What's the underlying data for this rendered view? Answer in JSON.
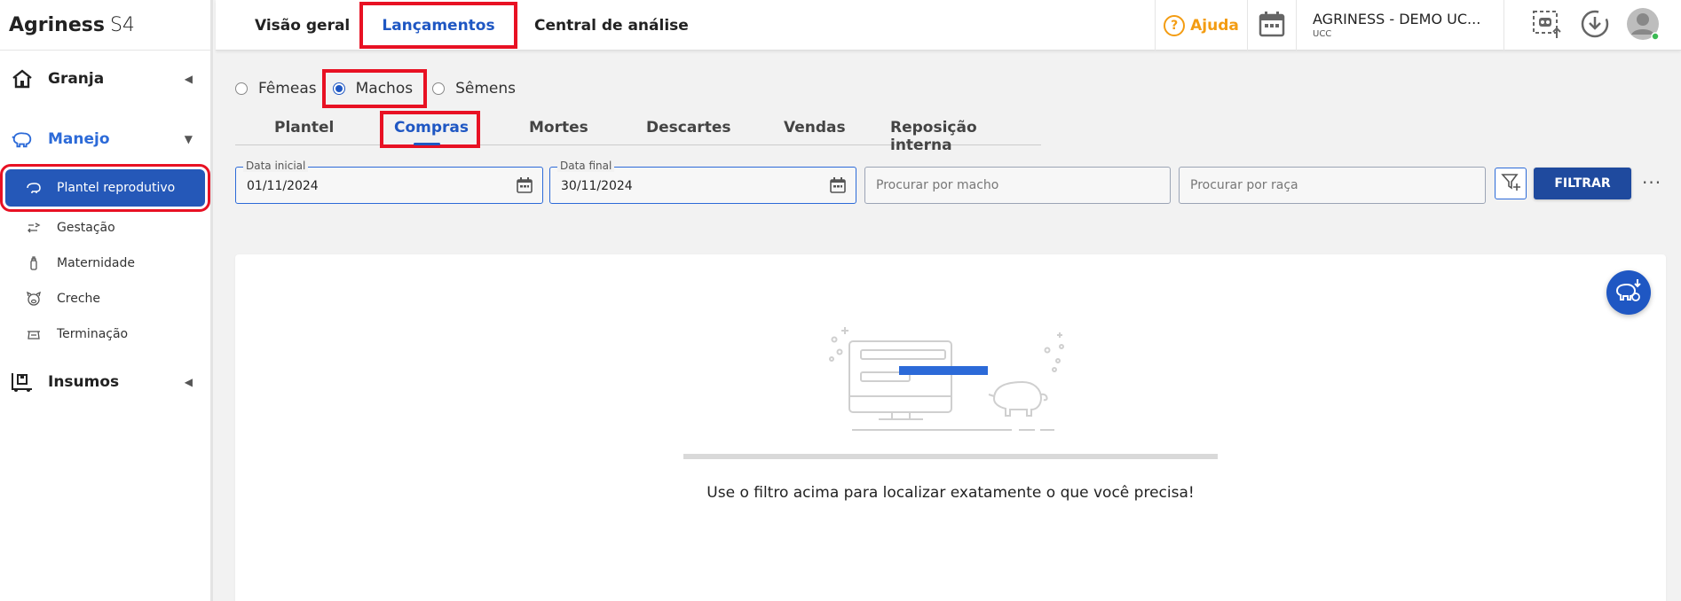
{
  "app": {
    "name": "Agriness",
    "version": "S4"
  },
  "sidebar": {
    "groups": [
      {
        "label": "Granja",
        "icon": "home-icon"
      },
      {
        "label": "Manejo",
        "icon": "pig-icon"
      },
      {
        "label": "Insumos",
        "icon": "supplies-icon"
      }
    ],
    "manejo_items": [
      {
        "label": "Plantel reprodutivo",
        "icon": "pig-outline-icon"
      },
      {
        "label": "Gestação",
        "icon": "gestation-icon"
      },
      {
        "label": "Maternidade",
        "icon": "bottle-icon"
      },
      {
        "label": "Creche",
        "icon": "piglet-face-icon"
      },
      {
        "label": "Terminação",
        "icon": "scale-icon"
      }
    ]
  },
  "topbar": {
    "tabs": [
      "Visão geral",
      "Lançamentos",
      "Central de análise"
    ],
    "active_tab": "Lançamentos",
    "help_label": "Ajuda",
    "farm_name": "AGRINESS - DEMO UC...",
    "farm_sub": "UCC"
  },
  "filters": {
    "sex_options": [
      "Fêmeas",
      "Machos",
      "Sêmens"
    ],
    "selected_sex": "Machos",
    "subtabs": [
      "Plantel",
      "Compras",
      "Mortes",
      "Descartes",
      "Vendas",
      "Reposição interna"
    ],
    "active_subtab": "Compras",
    "start_label": "Data inicial",
    "start_value": "01/11/2024",
    "end_label": "Data final",
    "end_value": "30/11/2024",
    "male_placeholder": "Procurar por macho",
    "breed_placeholder": "Procurar por raça",
    "filter_button": "FILTRAR",
    "more_label": "···"
  },
  "empty_state": {
    "message": "Use o filtro acima para localizar exatamente o que você precisa!"
  },
  "colors": {
    "primary": "#1f57c3",
    "sidebar_selected": "#2558b8",
    "help": "#f39c12",
    "highlight_box": "#e81123"
  }
}
